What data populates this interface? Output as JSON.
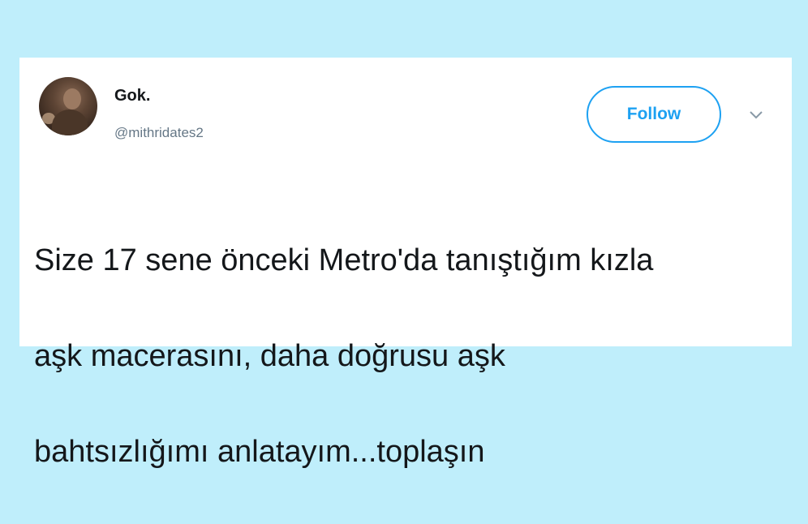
{
  "user": {
    "display_name": "Gok.",
    "handle": "@mithridates2",
    "avatar_icon": "user-avatar-photo"
  },
  "actions": {
    "follow_label": "Follow",
    "more_icon": "chevron-down-icon"
  },
  "tweet": {
    "lines": [
      "Size 17 sene önceki Metro'da tanıştığım kızla",
      "aşk macerasını, daha doğrusu aşk",
      "bahtsızlığımı anlatayım...toplaşın"
    ]
  },
  "colors": {
    "background": "#bfeefb",
    "card": "#ffffff",
    "accent": "#1da1f2",
    "text": "#14171a",
    "secondary_text": "#657786"
  }
}
